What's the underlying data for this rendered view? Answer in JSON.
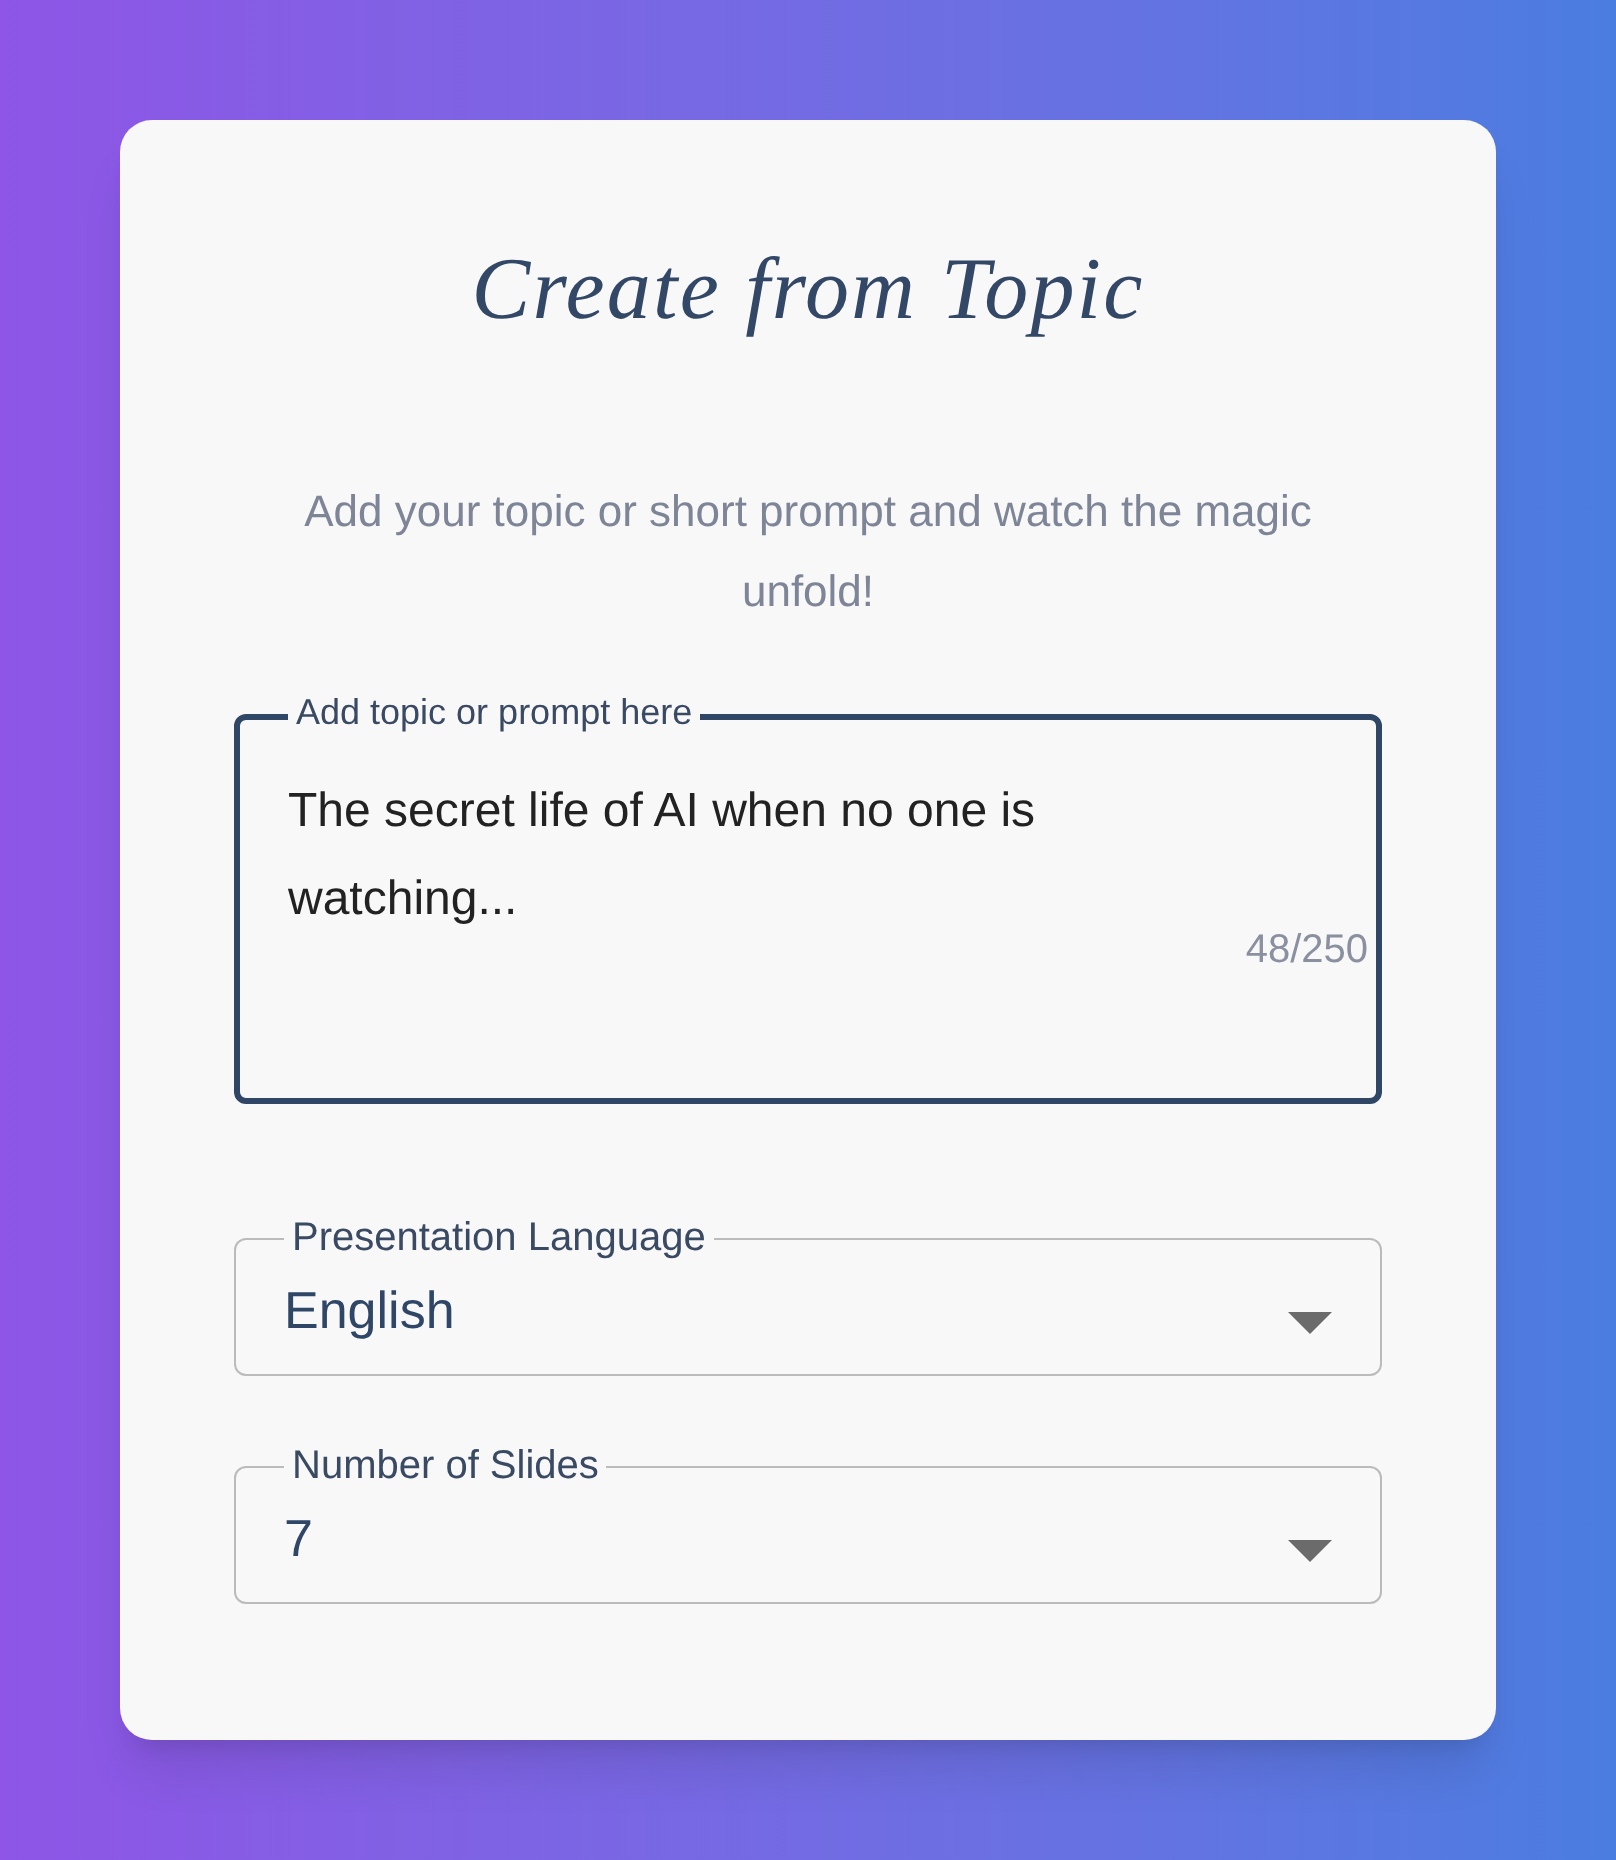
{
  "title": "Create from Topic",
  "subtitle": "Add your topic or short prompt and watch the magic unfold!",
  "prompt": {
    "label": "Add topic or prompt here",
    "value": "The secret life of AI when no one is watching...",
    "counter": "48/250",
    "focused": true
  },
  "selects": [
    {
      "label": "Presentation Language",
      "value": "English"
    },
    {
      "label": "Number of Slides",
      "value": "7"
    }
  ]
}
